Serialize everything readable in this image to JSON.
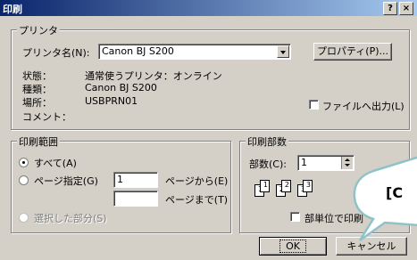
{
  "window": {
    "title": "印刷",
    "help_btn": "?",
    "close_btn": "×"
  },
  "printer_group": {
    "legend": "プリンタ",
    "name_label": "プリンタ名(N):",
    "name_value": "Canon BJ S200",
    "properties_button": "プロパティ(P)...",
    "status_label": "状態：",
    "status_value": "通常使うプリンタ：オンライン",
    "type_label": "種類：",
    "type_value": "Canon BJ S200",
    "location_label": "場所：",
    "location_value": "USBPRN01",
    "comment_label": "コメント：",
    "print_to_file": "ファイルへ出力(L)"
  },
  "range_group": {
    "legend": "印刷範囲",
    "all": "すべて(A)",
    "pages": "ページ指定(G)",
    "from_value": "1",
    "from_label": "ページから(E)",
    "to_value": "",
    "to_label": "ページまで(T)",
    "selection": "選択した部分(S)"
  },
  "copies_group": {
    "legend": "印刷部数",
    "copies_label": "部数(C):",
    "copies_value": "1",
    "collate": "部単位で印刷",
    "page_numbers": [
      "1",
      "1",
      "2",
      "2",
      "3",
      "3"
    ]
  },
  "buttons": {
    "ok": "OK",
    "cancel": "キャンセル"
  },
  "callout": {
    "text": "[C"
  }
}
